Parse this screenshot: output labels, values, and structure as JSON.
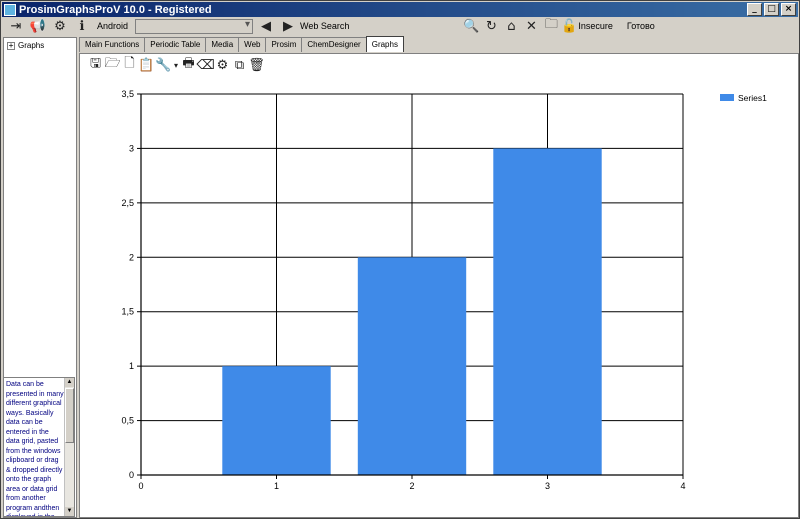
{
  "window": {
    "title": "ProsimGraphsProV 10.0 - Registered",
    "controls": [
      "_",
      "□",
      "×"
    ]
  },
  "toolbar": {
    "combo_label": "Android",
    "combo_value": "",
    "web_search": "Web Search",
    "insecure": "Insecure",
    "status": "Готово"
  },
  "tree": {
    "root": "Graphs"
  },
  "info_text": "Data can be presented in many different graphical ways. Basically data can be entered in the data grid, pasted from the windows clipboard or drag & dropped directly onto the graph area or data grid from another program andthen displayed in the graph area.",
  "tabs": [
    "Main Functions",
    "Periodic Table",
    "Media",
    "Web",
    "Prosim",
    "ChemDesigner",
    "Graphs"
  ],
  "active_tab": "Graphs",
  "colors": {
    "bar": "#3f8ae8",
    "title_start": "#0a246a",
    "title_end": "#3a6ea5",
    "info_text": "#000080"
  },
  "chart_data": {
    "type": "bar",
    "x": [
      1,
      2,
      3
    ],
    "values": [
      1,
      2,
      3
    ],
    "xlim": [
      0,
      4
    ],
    "ylim": [
      0,
      3.5
    ],
    "xticks": [
      "0",
      "1",
      "2",
      "3",
      "4"
    ],
    "yticks": [
      "0",
      "0,5",
      "1",
      "1,5",
      "2",
      "2,5",
      "3",
      "3,5"
    ],
    "series": [
      {
        "name": "Series1",
        "values": [
          1,
          2,
          3
        ]
      }
    ],
    "grid": true,
    "legend": "top-right"
  }
}
